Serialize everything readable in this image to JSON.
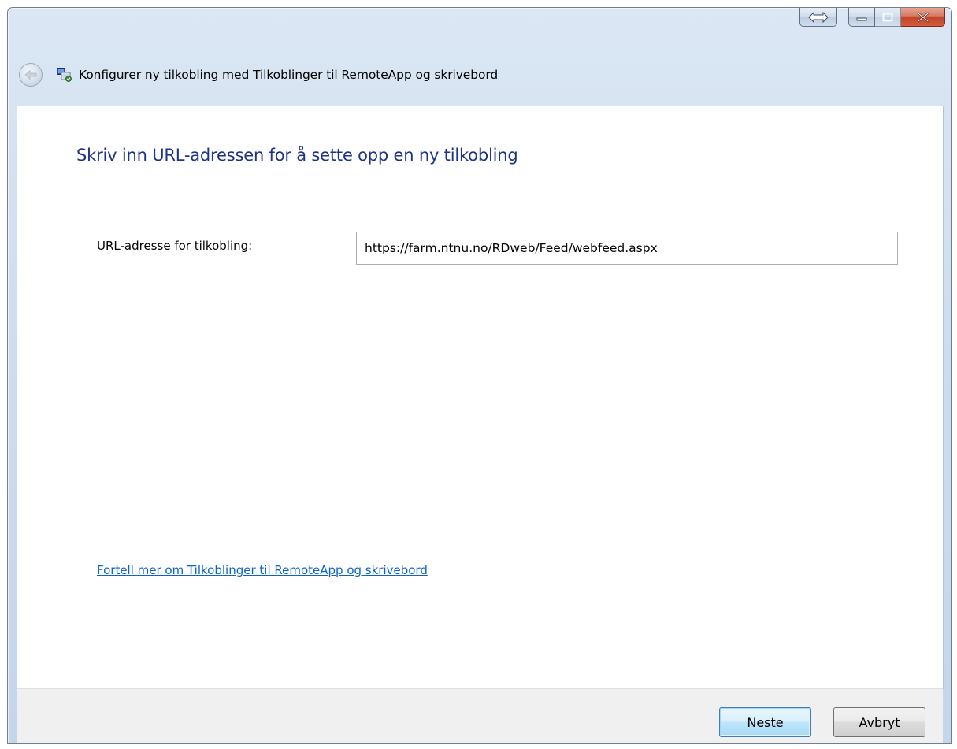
{
  "window": {
    "caption_buttons": {
      "snap_icon": "double-arrow-icon",
      "minimize_icon": "minimize-icon",
      "maximize_icon": "maximize-icon",
      "close_icon": "close-x-icon"
    }
  },
  "header": {
    "back_icon": "back-arrow-icon",
    "app_icon": "remoteapp-connection-icon",
    "title": "Konfigurer ny tilkobling med Tilkoblinger til RemoteApp og skrivebord"
  },
  "main": {
    "instruction": "Skriv inn URL-adressen for å sette opp en ny tilkobling",
    "url_label": "URL-adresse for tilkobling:",
    "url_value": "https://farm.ntnu.no/RDweb/Feed/webfeed.aspx",
    "help_link": "Fortell mer om Tilkoblinger til RemoteApp og skrivebord"
  },
  "footer": {
    "next_label": "Neste",
    "cancel_label": "Avbryt"
  },
  "colors": {
    "instruction_text": "#1e3287",
    "link": "#0b63c6",
    "close_button": "#c1432a"
  }
}
